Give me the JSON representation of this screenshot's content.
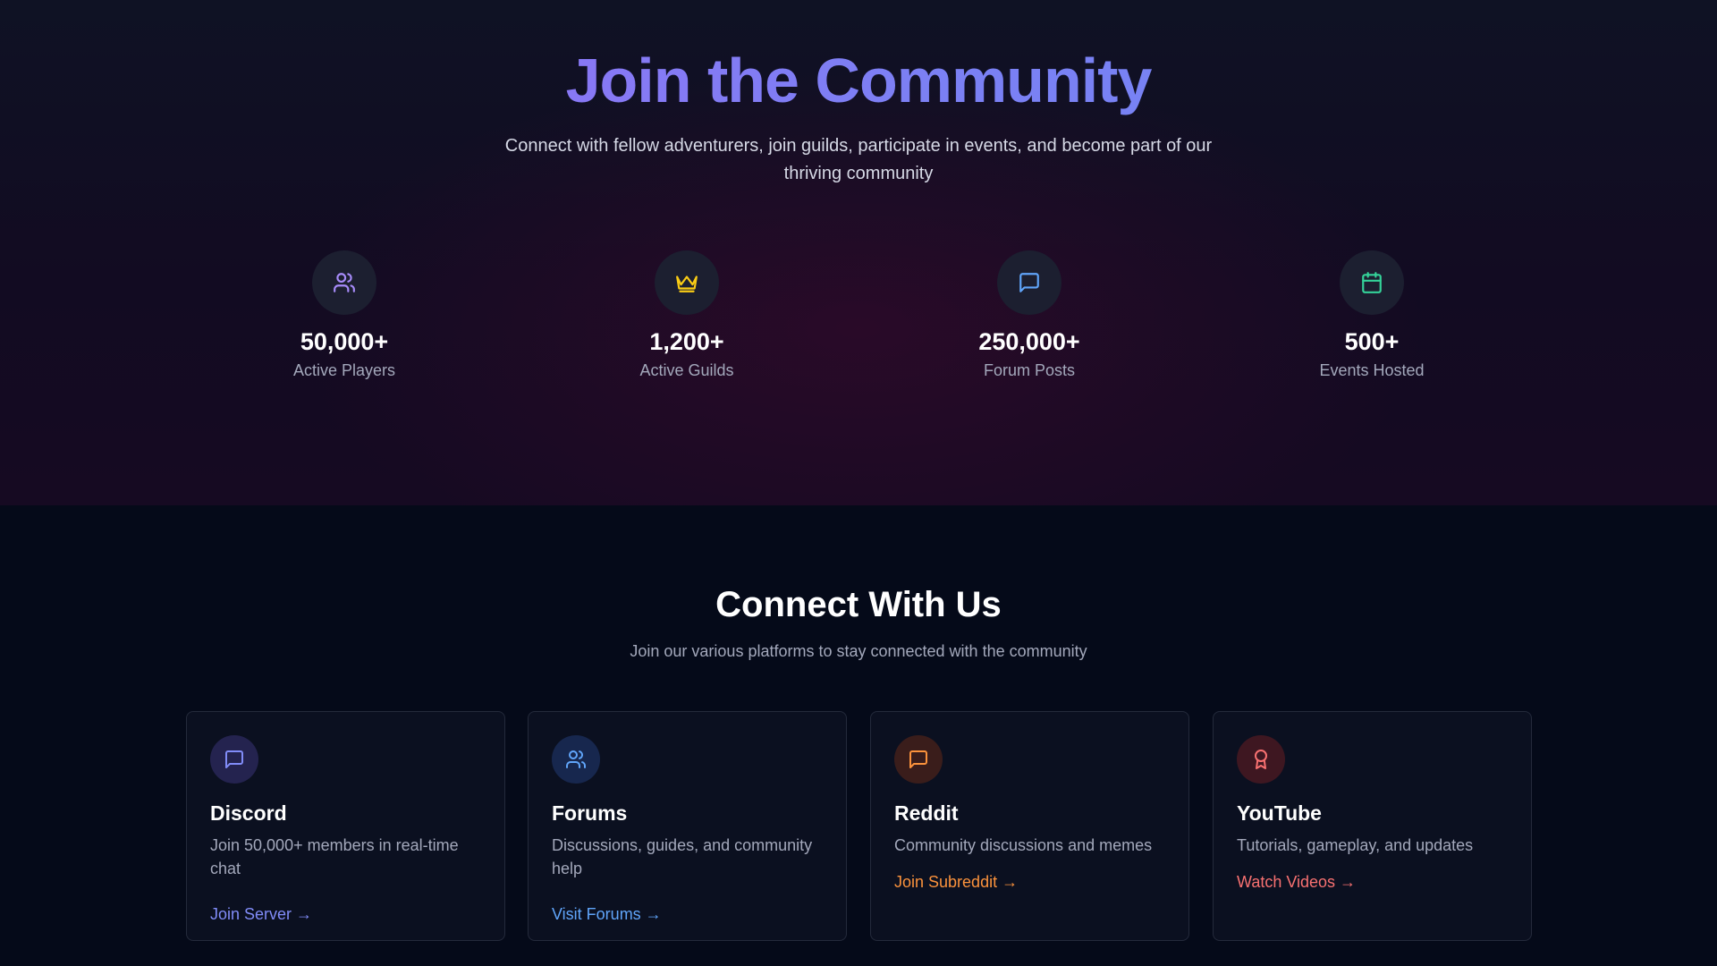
{
  "hero": {
    "title": "Join the Community",
    "subtitle": "Connect with fellow adventurers, join guilds, participate in events, and become part of our thriving community"
  },
  "stats": [
    {
      "icon": "users-icon",
      "color": "#a78bfa",
      "value": "50,000+",
      "label": "Active Players"
    },
    {
      "icon": "crown-icon",
      "color": "#facc15",
      "value": "1,200+",
      "label": "Active Guilds"
    },
    {
      "icon": "message-icon",
      "color": "#60a5fa",
      "value": "250,000+",
      "label": "Forum Posts"
    },
    {
      "icon": "calendar-icon",
      "color": "#34d399",
      "value": "500+",
      "label": "Events Hosted"
    }
  ],
  "connect": {
    "title": "Connect With Us",
    "subtitle": "Join our various platforms to stay connected with the community",
    "cards": [
      {
        "icon": "message-icon",
        "icon_color": "#818cf8",
        "icon_bg": "#24234f",
        "title": "Discord",
        "description": "Join 50,000+ members in real-time chat",
        "link": "Join Server →",
        "link_color": "#818cf8"
      },
      {
        "icon": "users-icon",
        "icon_color": "#60a5fa",
        "icon_bg": "#17274e",
        "title": "Forums",
        "description": "Discussions, guides, and community help",
        "link": "Visit Forums →",
        "link_color": "#60a5fa"
      },
      {
        "icon": "message-icon",
        "icon_color": "#fb923c",
        "icon_bg": "#3a1d1b",
        "title": "Reddit",
        "description": "Community discussions and memes",
        "link": "Join Subreddit →",
        "link_color": "#fb923c"
      },
      {
        "icon": "award-icon",
        "icon_color": "#f87171",
        "icon_bg": "#3e1721",
        "title": "YouTube",
        "description": "Tutorials, gameplay, and updates",
        "link": "Watch Videos →",
        "link_color": "#f87171"
      }
    ]
  }
}
